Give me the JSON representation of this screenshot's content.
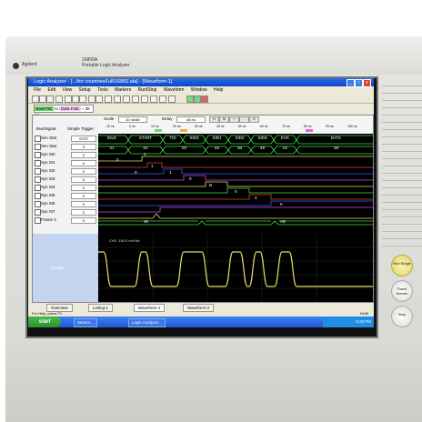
{
  "instrument": {
    "brand": "Agilent",
    "model_line1": "16800A",
    "model_line2": "Portable Logic Analyzer"
  },
  "window": {
    "title": "Logic Analyzer - [...\\for countriesFull\\16800.ala] - [Waveform-1]",
    "min_label": "_",
    "max_label": "□",
    "close_label": "x"
  },
  "menu": [
    "File",
    "Edit",
    "View",
    "Setup",
    "Tools",
    "Markers",
    "Run/Stop",
    "Waveform",
    "Window",
    "Help"
  ],
  "trigger_bar": {
    "part1": "Eval TIS",
    "part2": "to",
    "part3": "Dela Fold",
    "part4": "~ 38 ns"
  },
  "header": {
    "scale_label": "Scale",
    "scale_value": "10 ns/div",
    "delay_label": "Delay",
    "delay_value": "48 ns",
    "buttons": [
      "H",
      "M",
      "+",
      "-",
      "G"
    ]
  },
  "left_panel": {
    "col1": "Bus/Signal",
    "col2": "Simple Trigger",
    "rows": [
      {
        "name": "Sim Stat",
        "trigger": "STRT"
      },
      {
        "name": "Sim Stat",
        "trigger": "X"
      },
      {
        "name": "Sys St0",
        "trigger": "X"
      },
      {
        "name": "Sys St1",
        "trigger": "X"
      },
      {
        "name": "Sys St2",
        "trigger": "X"
      },
      {
        "name": "Sys St3",
        "trigger": "X"
      },
      {
        "name": "Sys St4",
        "trigger": "X"
      },
      {
        "name": "Sys St5",
        "trigger": "X"
      },
      {
        "name": "Sys St6",
        "trigger": "X"
      },
      {
        "name": "Sys St7",
        "trigger": "X"
      },
      {
        "name": "Frame 4",
        "trigger": "X"
      }
    ],
    "lower_label": "ZOOM"
  },
  "ruler": {
    "ticks": [
      "-10 ns",
      "0 ns",
      "10 ns",
      "20 ns",
      "30 ns",
      "40 ns",
      "50 ns",
      "60 ns",
      "70 ns",
      "80 ns",
      "90 ns",
      "100 ns"
    ]
  },
  "bus_states": [
    "IDLE",
    "START",
    "TID",
    "SID3",
    "SID1",
    "SID2",
    "SID3",
    "EVK",
    "DATA"
  ],
  "bus_values": [
    "21",
    "02",
    "04",
    "04",
    "1B",
    "48",
    "52",
    "39"
  ],
  "wave_values": [
    "1",
    "0",
    "1",
    "0",
    "1",
    "0",
    "B",
    "0",
    "4",
    "0",
    "40",
    "AD"
  ],
  "scope_label": "CH1: 150.0 mV/div",
  "tabs": [
    "Overview",
    "Listing-1",
    "Waveform-1",
    "Waveform-2"
  ],
  "status": "For Help, press F1",
  "status_right": "NUM",
  "taskbar": {
    "start": "start",
    "items": [
      "Sensor...",
      "Logic Analyzer..."
    ],
    "clock": "8:28 PM"
  },
  "knobs": [
    {
      "label": "Run Single",
      "accent": "#e6d66a"
    },
    {
      "label": "Touch Screen",
      "accent": ""
    },
    {
      "label": "Stop",
      "accent": ""
    }
  ],
  "colors": {
    "title_bar": "#0b46c8",
    "wave_bg": "#000000",
    "trace_yellow": "#e8e060",
    "trace_green": "#40e040",
    "trace_red": "#e04040",
    "trace_blue": "#3060ff",
    "trace_magenta": "#e040e0"
  }
}
